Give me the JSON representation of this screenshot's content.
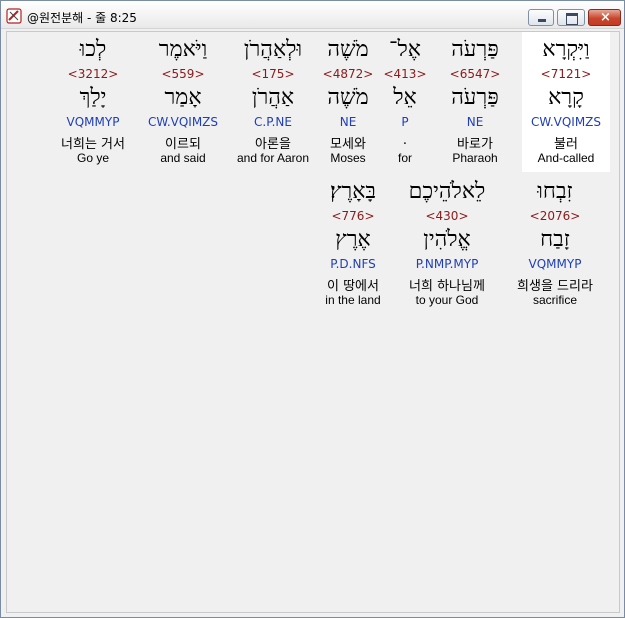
{
  "window": {
    "title": "@원전분해 - 줄 8:25",
    "close_glyph": "×"
  },
  "verse": {
    "row1": [
      {
        "hebrew": "וַיִּקְרָא",
        "strong": "<7121>",
        "lemma": "קָרָא",
        "parse": "CW.VQIMZS",
        "korean": "불러",
        "english": "And-called"
      },
      {
        "hebrew": "פַּרְעֹה",
        "strong": "<6547>",
        "lemma": "פַּרְעֹה",
        "parse": "NE",
        "korean": "바로가",
        "english": "Pharaoh"
      },
      {
        "hebrew": "אֶל־",
        "strong": "<413>",
        "lemma": "אֵל",
        "parse": "P",
        "korean": ".",
        "english": "for"
      },
      {
        "hebrew": "מֹשֶׁה",
        "strong": "<4872>",
        "lemma": "מֹשֶׁה",
        "parse": "NE",
        "korean": "모세와",
        "english": "Moses"
      },
      {
        "hebrew": "וּלְאַהֲרֹן",
        "strong": "<175>",
        "lemma": "אַהֲרֹן",
        "parse": "C.P.NE",
        "korean": "아론을",
        "english": "and for Aaron"
      },
      {
        "hebrew": "וַיֹּאמֶר",
        "strong": "<559>",
        "lemma": "אָמַר",
        "parse": "CW.VQIMZS",
        "korean": "이르되",
        "english": "and said"
      },
      {
        "hebrew": "לְכוּ",
        "strong": "<3212>",
        "lemma": "יָלַךְ",
        "parse": "VQMMYP",
        "korean": "너희는 거서",
        "english": "Go ye"
      }
    ],
    "row2": [
      {
        "hebrew": "זִבְחוּ",
        "strong": "<2076>",
        "lemma": "זָבַח",
        "parse": "VQMMYP",
        "korean": "희생을 드리라",
        "english": "sacrifice"
      },
      {
        "hebrew": "לֵאלֹהֵיכֶם",
        "strong": "<430>",
        "lemma": "אֱלֹהִין",
        "parse": "P.NMP.MYP",
        "korean": "너희 하나님께",
        "english": "to your God"
      },
      {
        "hebrew": "בָּאָרֶץ׃",
        "strong": "<776>",
        "lemma": "אֶרֶץ",
        "parse": "P.D.NFS",
        "korean": "이 땅에서",
        "english": "in the land"
      }
    ]
  },
  "colors": {
    "strong": "#8b1a1a",
    "parse": "#1f3fb4",
    "selected_bg": "#ffffff",
    "panel_bg": "#f0f0f0"
  }
}
